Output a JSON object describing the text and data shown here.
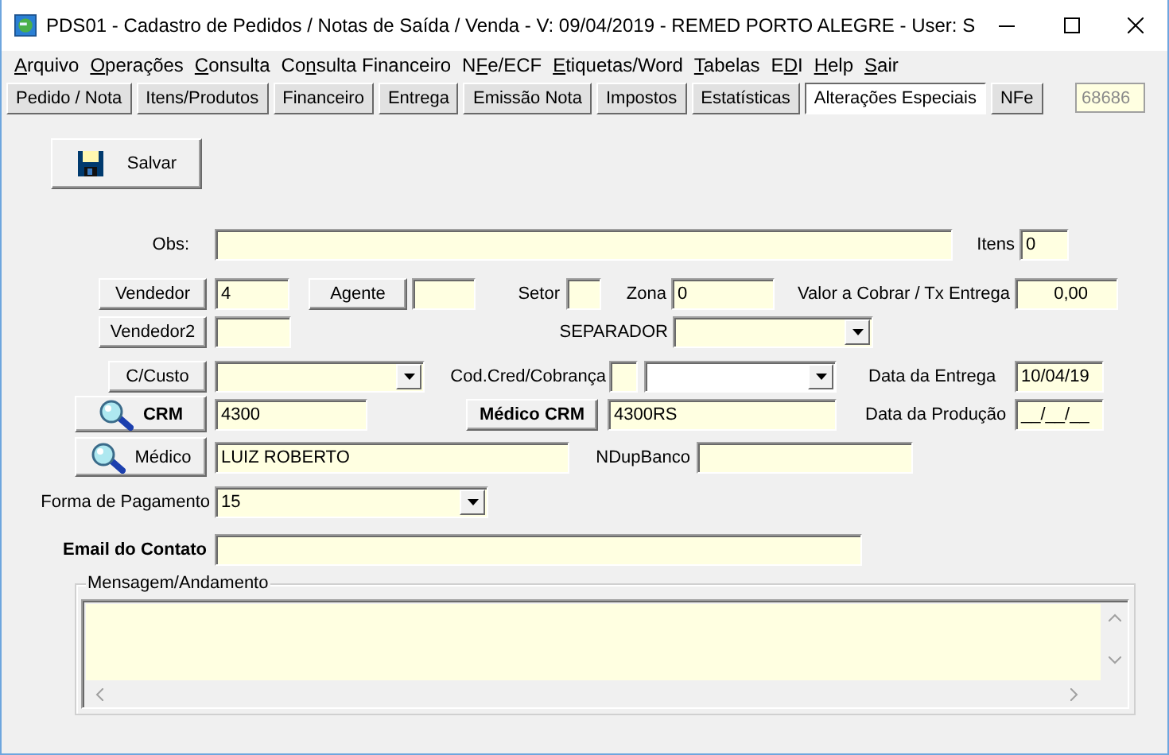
{
  "window": {
    "title": "PDS01 - Cadastro de Pedidos / Notas de Saída / Venda - V: 09/04/2019 - REMED PORTO ALEGRE - User: S"
  },
  "menu": [
    {
      "key": "A",
      "after": "rquivo"
    },
    {
      "key": "O",
      "after": "perações"
    },
    {
      "key": "C",
      "after": "onsulta"
    },
    {
      "before": "Co",
      "key": "n",
      "after": "sulta Financeiro"
    },
    {
      "before": "N",
      "key": "F",
      "after": "e/ECF"
    },
    {
      "key": "E",
      "after": "tiquetas/Word"
    },
    {
      "key": "T",
      "after": "abelas"
    },
    {
      "before": "E",
      "key": "D",
      "after": "I"
    },
    {
      "key": "H",
      "after": "elp"
    },
    {
      "key": "S",
      "after": "air"
    }
  ],
  "tabs": [
    {
      "label": "Pedido / Nota",
      "selected": false
    },
    {
      "label": "Itens/Produtos",
      "selected": false
    },
    {
      "label": "Financeiro",
      "selected": false
    },
    {
      "label": "Entrega",
      "selected": false
    },
    {
      "label": "Emissão Nota",
      "selected": false
    },
    {
      "label": "Impostos",
      "selected": false
    },
    {
      "label": "Estatísticas",
      "selected": false
    },
    {
      "label": "Alterações Especiais",
      "selected": true
    },
    {
      "label": "NFe",
      "selected": false
    }
  ],
  "order_number": {
    "value": "68686",
    "disabled": true
  },
  "rows": [
    {
      "items": [
        {
          "kind": "savebutton",
          "text": "Salvar"
        }
      ]
    },
    {
      "items": [
        {
          "kind": "label",
          "text": "Obs:"
        },
        {
          "kind": "field",
          "value": ""
        },
        {
          "kind": "label",
          "text": "Itens"
        },
        {
          "kind": "field",
          "value": "0"
        }
      ]
    },
    {
      "items": [
        {
          "kind": "button",
          "text": "Vendedor",
          "bold": false
        },
        {
          "kind": "field",
          "value": "4"
        },
        {
          "kind": "button",
          "text": "Agente",
          "bold": false
        },
        {
          "kind": "field",
          "value": ""
        },
        {
          "kind": "label",
          "text": "Setor"
        },
        {
          "kind": "field",
          "value": ""
        },
        {
          "kind": "label",
          "text": "Zona"
        },
        {
          "kind": "field",
          "value": "0"
        },
        {
          "kind": "label",
          "text": "Valor a Cobrar / Tx Entrega"
        },
        {
          "kind": "numfield",
          "value": "0,00"
        }
      ]
    },
    {
      "items": [
        {
          "kind": "button",
          "text": "Vendedor2",
          "bold": false
        },
        {
          "kind": "field",
          "value": ""
        },
        {
          "kind": "label",
          "text": "SEPARADOR"
        },
        {
          "kind": "combo",
          "value": ""
        }
      ]
    },
    {
      "items": [
        {
          "kind": "button",
          "text": "C/Custo",
          "bold": false
        },
        {
          "kind": "combo",
          "value": ""
        },
        {
          "kind": "label",
          "text": "Cod.Cred/Cobrança"
        },
        {
          "kind": "field",
          "value": ""
        },
        {
          "kind": "plaincombo",
          "value": ""
        },
        {
          "kind": "label",
          "text": "Data da Entrega"
        },
        {
          "kind": "field",
          "value": "10/04/19"
        }
      ]
    },
    {
      "items": [
        {
          "kind": "lookupbutton",
          "text": "CRM",
          "bold": true
        },
        {
          "kind": "field",
          "value": "4300"
        },
        {
          "kind": "button",
          "text": "Médico CRM",
          "bold": true
        },
        {
          "kind": "field",
          "value": "4300RS"
        },
        {
          "kind": "label",
          "text": "Data da Produção"
        },
        {
          "kind": "field",
          "value": "__/__/__"
        }
      ]
    },
    {
      "items": [
        {
          "kind": "lookupbutton",
          "text": "Médico",
          "bold": false
        },
        {
          "kind": "field",
          "value": "LUIZ ROBERTO"
        },
        {
          "kind": "label",
          "text": "NDupBanco"
        },
        {
          "kind": "field",
          "value": ""
        }
      ]
    },
    {
      "items": [
        {
          "kind": "label",
          "text": "Forma de Pagamento"
        },
        {
          "kind": "combo",
          "value": "15"
        }
      ]
    },
    {
      "items": [
        {
          "kind": "boldlabel",
          "text": "Email do Contato"
        },
        {
          "kind": "field",
          "value": ""
        }
      ]
    }
  ],
  "message_group": {
    "title": "Mensagem/Andamento"
  }
}
